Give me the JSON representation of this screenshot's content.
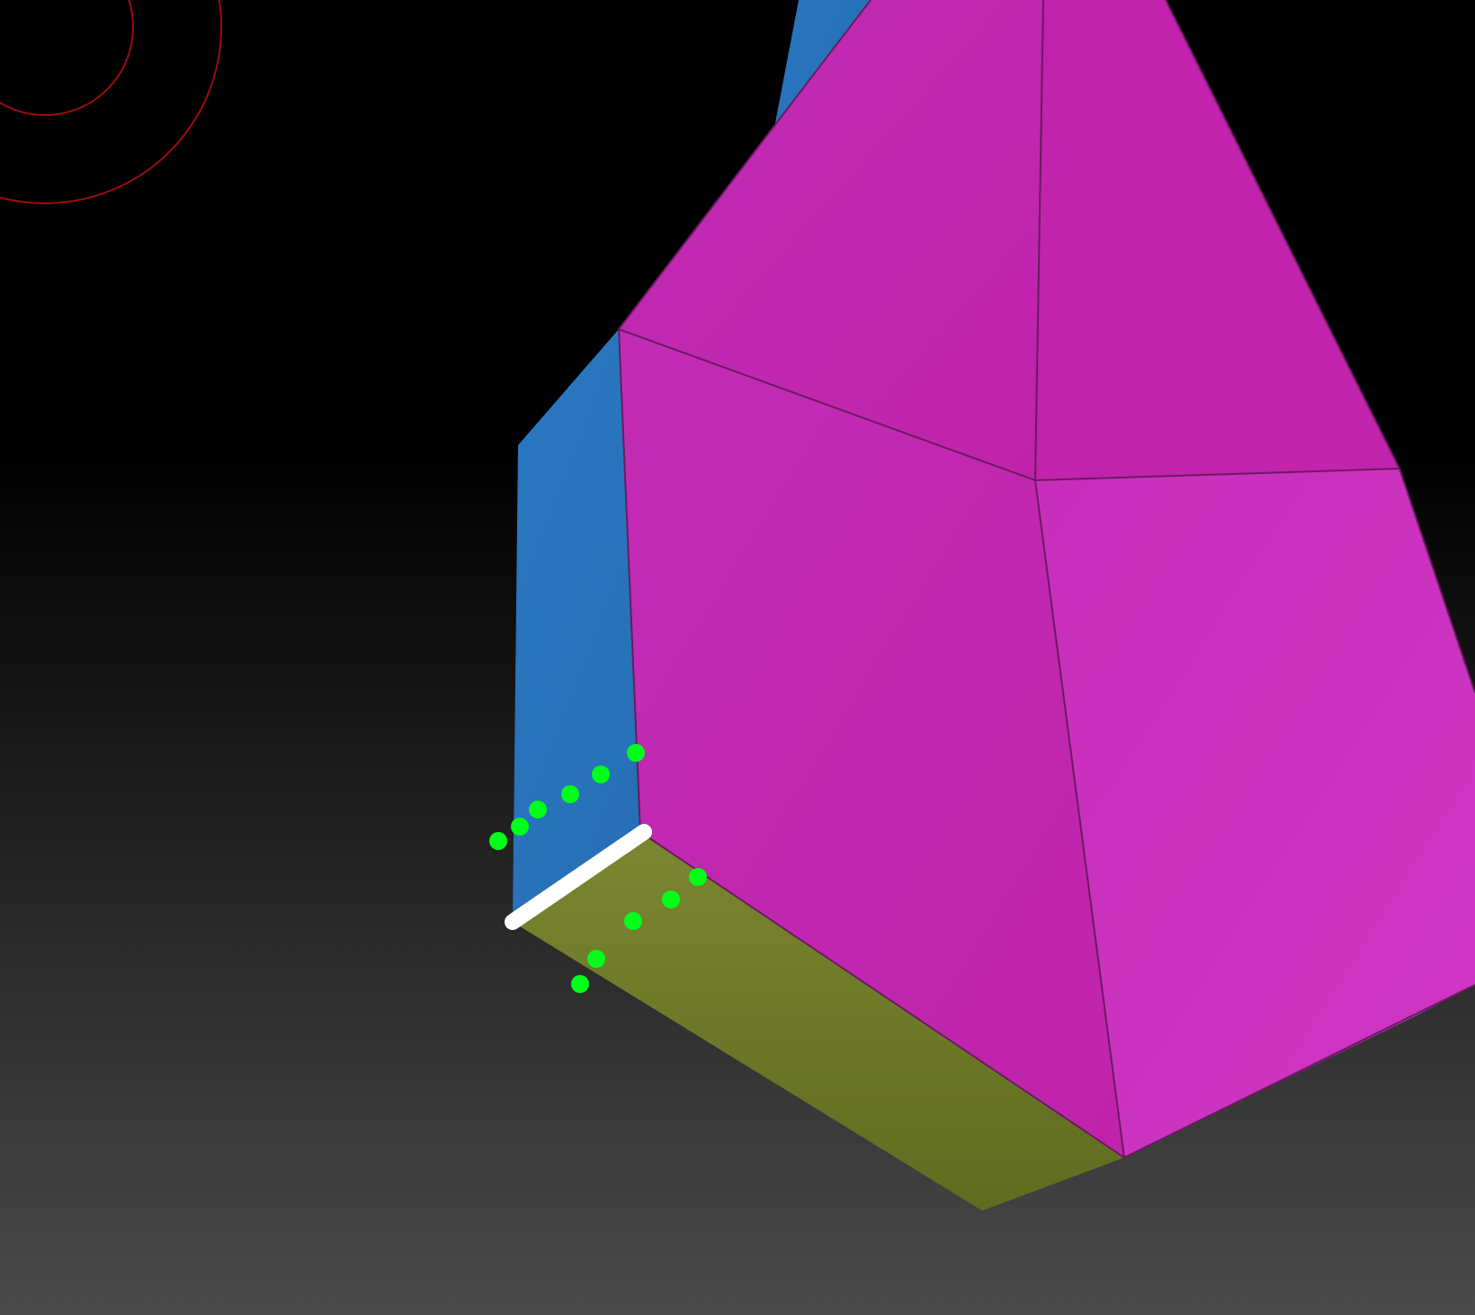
{
  "viewport": {
    "background": {
      "top": "#000000",
      "bottom": "#4a4a4a"
    },
    "colors": {
      "magenta_face": "#c628b4",
      "magenta_face_light": "#cc34be",
      "blue_face": "#2a73b8",
      "olive_face": "#768227",
      "olive_face_dark": "#5f6b1f",
      "wire_edge": "#6a1a60",
      "selected_edge": "#ffffff",
      "points": "#00ff1a",
      "brush_cursor": "#9b0d0d"
    },
    "icons": {
      "brush_cursor": "brush-cursor-icon",
      "selected_edge": "selected-edge-icon"
    },
    "mesh": {
      "faces": [
        "blue-left",
        "magenta-upper-left",
        "magenta-upper-right",
        "magenta-lower-left",
        "magenta-lower-right",
        "olive-bottom"
      ],
      "edge_count": 1,
      "point_groups": 2
    }
  }
}
